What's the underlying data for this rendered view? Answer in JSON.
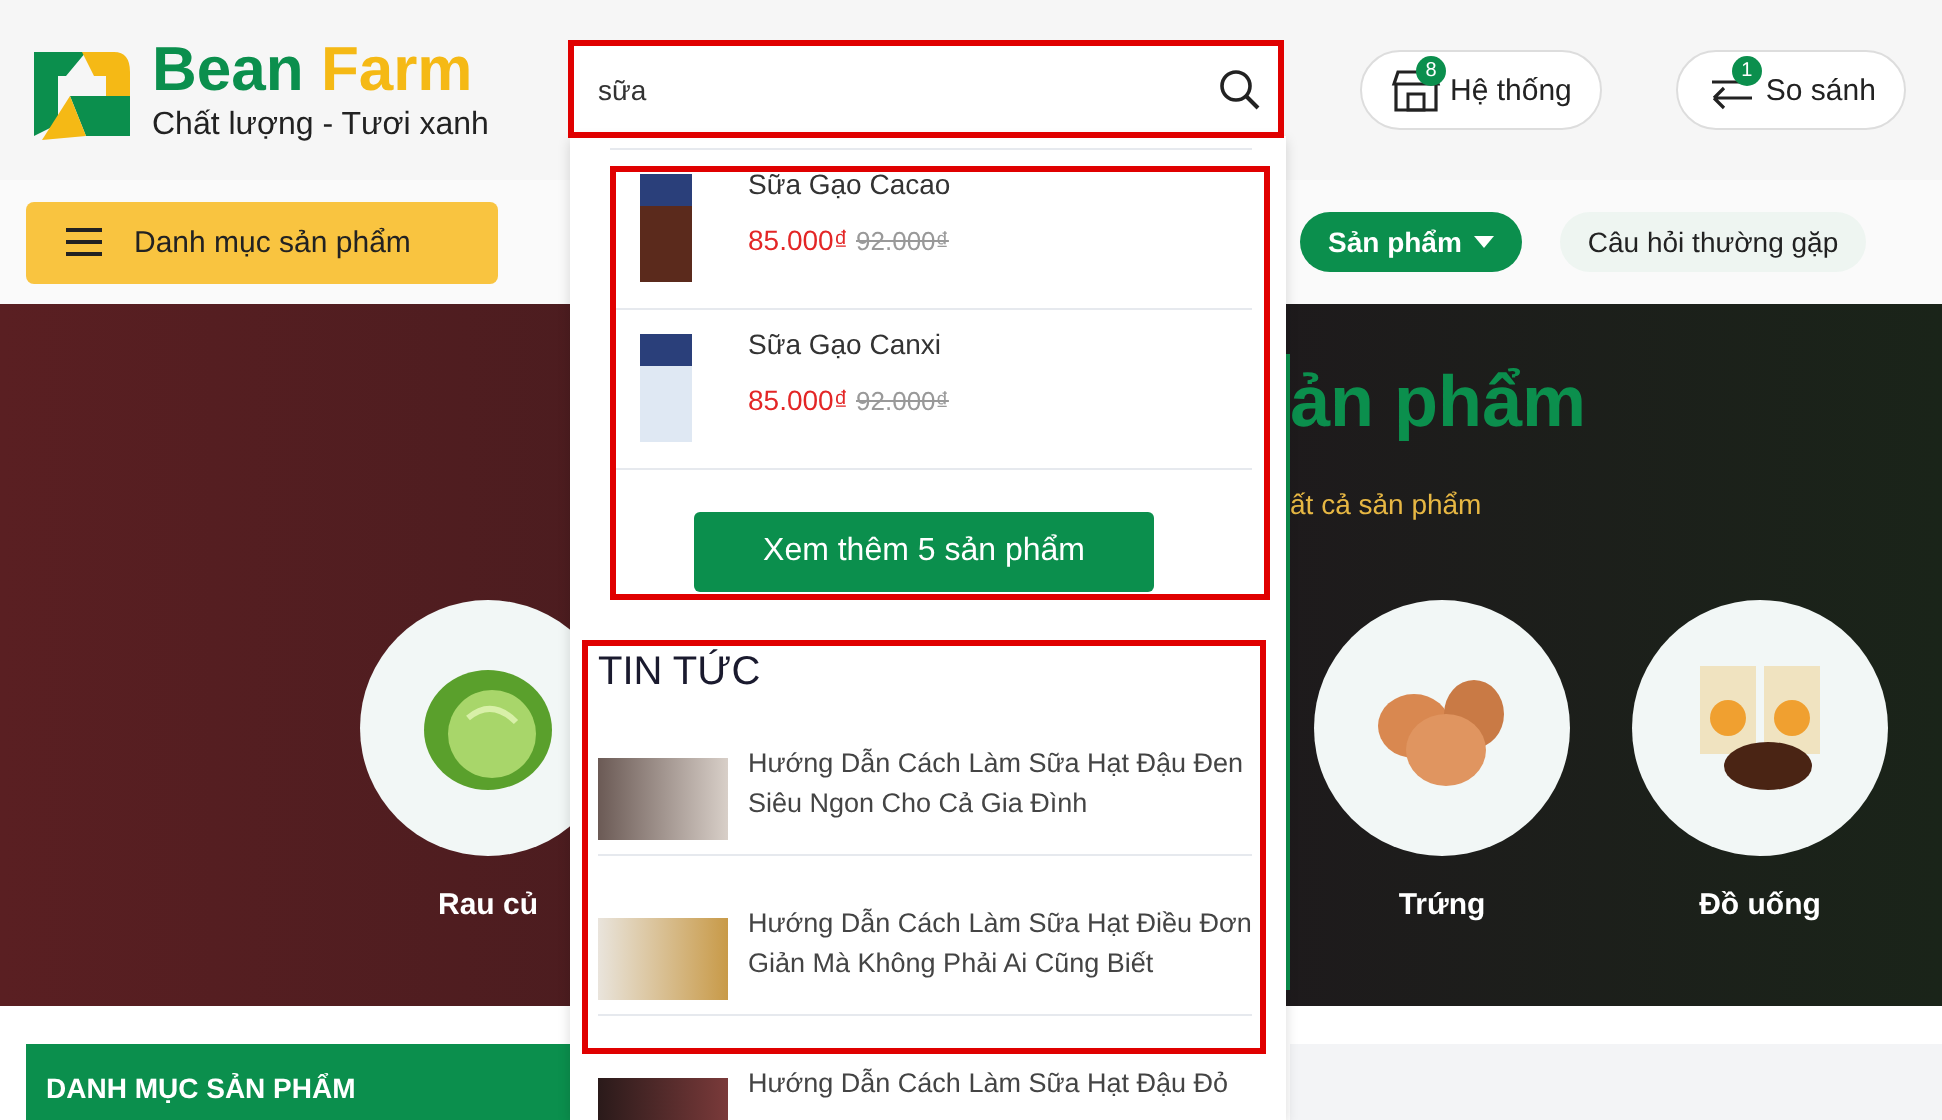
{
  "header": {
    "logo": {
      "brand_primary": "Bean",
      "brand_secondary": "Farm",
      "tagline": "Chất lượng - Tươi xanh"
    },
    "search": {
      "value": "sữa"
    },
    "actions": [
      {
        "kind": "store",
        "label": "Hệ thống",
        "badge": "8"
      },
      {
        "kind": "compare",
        "label": "So sánh",
        "badge": "1"
      }
    ]
  },
  "nav": {
    "category_button": "Danh mục sản phẩm",
    "links": [
      {
        "label": "Sản phẩm",
        "selected": true
      },
      {
        "label": "Câu hỏi thường gặp",
        "selected": false
      }
    ]
  },
  "hero": {
    "title": "ản phẩm",
    "subtitle": "ất cả sản phẩm",
    "categories": [
      {
        "kind": "cabbage",
        "label": "Rau củ"
      },
      {
        "kind": "eggs",
        "label": "Trứng"
      },
      {
        "kind": "snack",
        "label": "Đồ uống"
      }
    ]
  },
  "search_results": {
    "products": [
      {
        "kind": "cacao",
        "name": "Sữa Gạo Cacao",
        "price": "85.000₫",
        "old_price": "92.000₫"
      },
      {
        "kind": "calcium",
        "name": "Sữa Gạo Canxi",
        "price": "85.000₫",
        "old_price": "92.000₫"
      }
    ],
    "more_button": "Xem thêm 5 sản phẩm",
    "news_heading": "TIN TỨC",
    "news": [
      {
        "title": "Hướng Dẫn Cách Làm Sữa Hạt Đậu Đen Siêu Ngon Cho Cả Gia Đình"
      },
      {
        "title": "Hướng Dẫn Cách Làm Sữa Hạt Điều Đơn Giản Mà Không Phải Ai Cũng Biết"
      },
      {
        "title": "Hướng Dẫn Cách Làm Sữa Hạt Đậu Đỏ"
      }
    ]
  },
  "sidebar": {
    "heading": "DANH MỤC SẢN PHẨM"
  }
}
